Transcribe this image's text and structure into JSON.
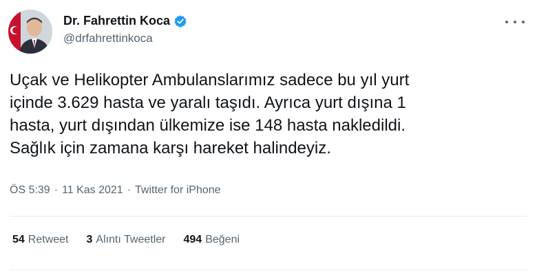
{
  "author": {
    "display_name": "Dr. Fahrettin Koca",
    "handle": "@drfahrettinkoca",
    "verified": true,
    "avatar_icon": "profile-photo"
  },
  "tweet": {
    "lines": [
      "Uçak ve Helikopter Ambulanslarımız sadece bu yıl yurt",
      "içinde 3.629 hasta ve yaralı taşıdı. Ayrıca yurt dışına 1",
      "hasta, yurt dışından ülkemize ise 148 hasta nakledildi.",
      "Sağlık için zamana karşı hareket halindeyiz."
    ]
  },
  "meta": {
    "time": "ÖS 5:39",
    "separator": "·",
    "date": "11 Kas 2021",
    "source": "Twitter for iPhone"
  },
  "stats": {
    "retweets": {
      "count": "54",
      "label": "Retweet"
    },
    "quotes": {
      "count": "3",
      "label": "Alıntı Tweetler"
    },
    "likes": {
      "count": "494",
      "label": "Beğeni"
    }
  },
  "colors": {
    "verified_badge": "#1d9bf0",
    "secondary_text": "#536471",
    "primary_text": "#0f1419"
  },
  "icons": {
    "more": "more-dots-icon",
    "verified": "verified-badge-icon"
  }
}
